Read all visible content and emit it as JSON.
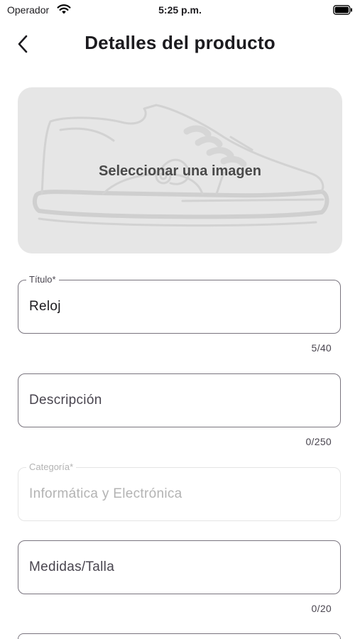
{
  "status_bar": {
    "carrier": "Operador",
    "time": "5:25 p.m."
  },
  "header": {
    "title": "Detalles del producto"
  },
  "image_picker": {
    "label": "Seleccionar una imagen"
  },
  "form": {
    "title_field": {
      "label": "Título*",
      "value": "Reloj",
      "counter": "5/40"
    },
    "description_field": {
      "placeholder": "Descripción",
      "counter": "0/250"
    },
    "category_field": {
      "label": "Categoría*",
      "value": "Informática y Electrónica"
    },
    "size_field": {
      "placeholder": "Medidas/Talla",
      "counter": "0/20"
    }
  },
  "colors": {
    "outline": "#79747e",
    "disabled_outline": "#e5e5e5",
    "picker_background": "#e6e6e6"
  }
}
